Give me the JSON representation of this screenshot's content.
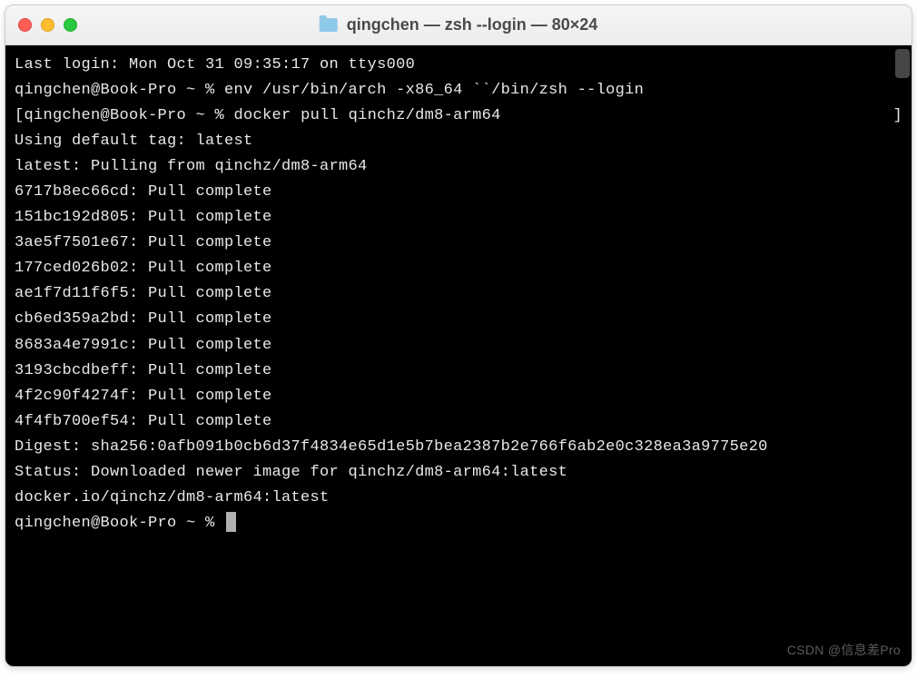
{
  "window": {
    "title": "qingchen — zsh --login — 80×24"
  },
  "terminal": {
    "lines": [
      "Last login: Mon Oct 31 09:35:17 on ttys000",
      "qingchen@Book-Pro ~ % env /usr/bin/arch -x86_64 ``/bin/zsh --login",
      "qingchen@Book-Pro ~ % docker pull qinchz/dm8-arm64",
      "Using default tag: latest",
      "latest: Pulling from qinchz/dm8-arm64",
      "6717b8ec66cd: Pull complete",
      "151bc192d805: Pull complete",
      "3ae5f7501e67: Pull complete",
      "177ced026b02: Pull complete",
      "ae1f7d11f6f5: Pull complete",
      "cb6ed359a2bd: Pull complete",
      "8683a4e7991c: Pull complete",
      "3193cbcdbeff: Pull complete",
      "4f2c90f4274f: Pull complete",
      "4f4fb700ef54: Pull complete",
      "Digest: sha256:0afb091b0cb6d37f4834e65d1e5b7bea2387b2e766f6ab2e0c328ea3a9775e20",
      "Status: Downloaded newer image for qinchz/dm8-arm64:latest",
      "docker.io/qinchz/dm8-arm64:latest"
    ],
    "prompt": "qingchen@Book-Pro ~ % "
  },
  "watermark": "CSDN @信息差Pro"
}
